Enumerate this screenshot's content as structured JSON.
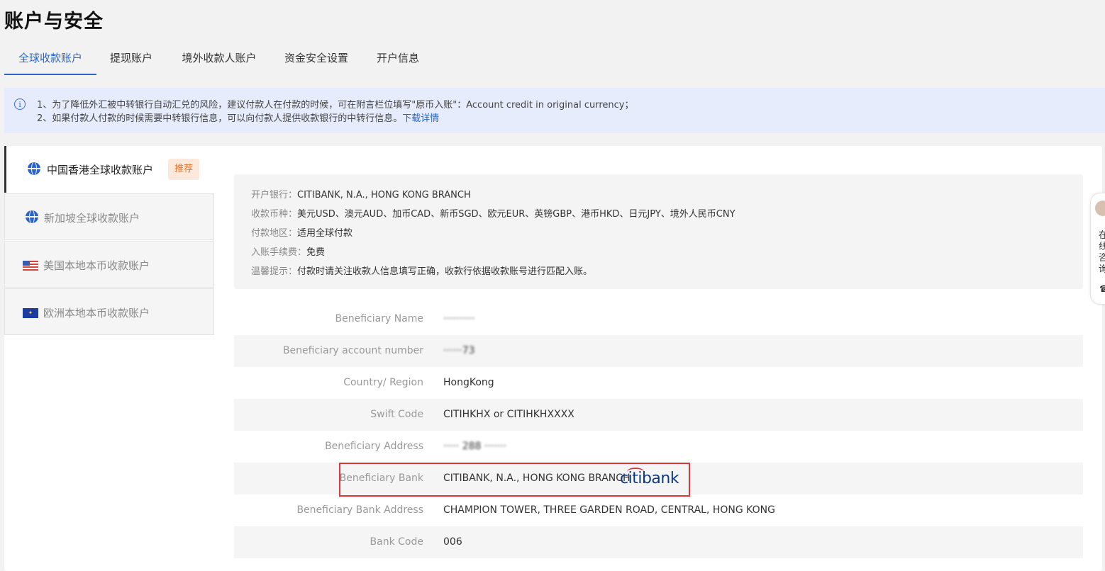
{
  "page_title": "账户与安全",
  "tabs": [
    {
      "label": "全球收款账户"
    },
    {
      "label": "提现账户"
    },
    {
      "label": "境外收款人账户"
    },
    {
      "label": "资金安全设置"
    },
    {
      "label": "开户信息"
    }
  ],
  "notice": {
    "line1": "1、为了降低外汇被中转银行自动汇兑的风险，建议付款人在付款的时候，可在附言栏位填写\"原币入账\"：Account credit in original currency；",
    "line2": "2、如果付款人付款的时候需要中转银行信息，可以向付款人提供收款银行的中转行信息。",
    "link": "下载详情"
  },
  "sidebar": {
    "items": [
      {
        "label": "中国香港全球收款账户",
        "tag": "推荐"
      },
      {
        "label": "新加坡全球收款账户"
      },
      {
        "label": "美国本地本币收款账户"
      },
      {
        "label": "欧洲本地本币收款账户"
      }
    ]
  },
  "info": {
    "bank_k": "开户银行：",
    "bank_v": "CITIBANK, N.A., HONG KONG BRANCH",
    "currency_k": "收款币种：",
    "currency_v": "美元USD、澳元AUD、加币CAD、新币SGD、欧元EUR、英镑GBP、港币HKD、日元JPY、境外人民币CNY",
    "region_k": "付款地区：",
    "region_v": "适用全球付款",
    "fee_k": "入账手续费：",
    "fee_v": "免费",
    "tip_k": "温馨提示：",
    "tip_v": "付款时请关注收款人信息填写正确，收款行依据收款账号进行匹配入账。"
  },
  "details": [
    {
      "label": "Beneficiary Name",
      "value": "··········"
    },
    {
      "label": "Beneficiary account number",
      "value": "······73"
    },
    {
      "label": "Country/ Region",
      "value": "HongKong"
    },
    {
      "label": "Swift Code",
      "value": "CITIHKHX or CITIHKHXXXX"
    },
    {
      "label": "Beneficiary Address",
      "value": "····· 288 ·······"
    },
    {
      "label": "Beneficiary Bank",
      "value": "CITIBANK, N.A., HONG KONG BRANCH"
    },
    {
      "label": "Beneficiary Bank Address",
      "value": "CHAMPION TOWER, THREE GARDEN ROAD, CENTRAL, HONG KONG"
    },
    {
      "label": "Bank Code",
      "value": "006"
    }
  ],
  "bank_logo_text": "citibank",
  "float_widget": {
    "text": "在线咨询"
  },
  "colors": {
    "accent": "#2a64c8",
    "tag_bg": "#fde9dc",
    "tag_text": "#e8742c",
    "highlight": "#d9363e"
  }
}
